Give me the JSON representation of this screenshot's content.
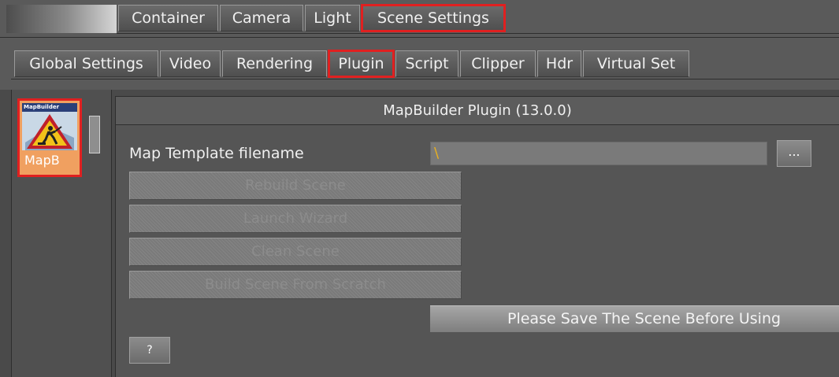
{
  "top_tabs": [
    {
      "label": "Container"
    },
    {
      "label": "Camera"
    },
    {
      "label": "Light"
    },
    {
      "label": "Scene Settings"
    }
  ],
  "sub_tabs": [
    {
      "label": "Global Settings"
    },
    {
      "label": "Video"
    },
    {
      "label": "Rendering"
    },
    {
      "label": "Plugin"
    },
    {
      "label": "Script"
    },
    {
      "label": "Clipper"
    },
    {
      "label": "Hdr"
    },
    {
      "label": "Virtual Set"
    }
  ],
  "plugin_list": {
    "item_label": "MapB",
    "icon_caption": "MapBuilder",
    "icon": "construction-warning-icon"
  },
  "panel": {
    "title": "MapBuilder Plugin (13.0.0)",
    "map_template_label": "Map Template filename",
    "map_template_value": "\\",
    "browse_label": "...",
    "buttons": [
      {
        "label": "Rebuild Scene"
      },
      {
        "label": "Launch Wizard"
      },
      {
        "label": "Clean Scene"
      },
      {
        "label": "Build Scene From Scratch"
      }
    ],
    "notice": "Please Save The Scene Before Using",
    "help_label": "?"
  },
  "colors": {
    "highlight": "#e02020",
    "plugin_tile": "#f0a060",
    "input_text": "#e8b020"
  }
}
